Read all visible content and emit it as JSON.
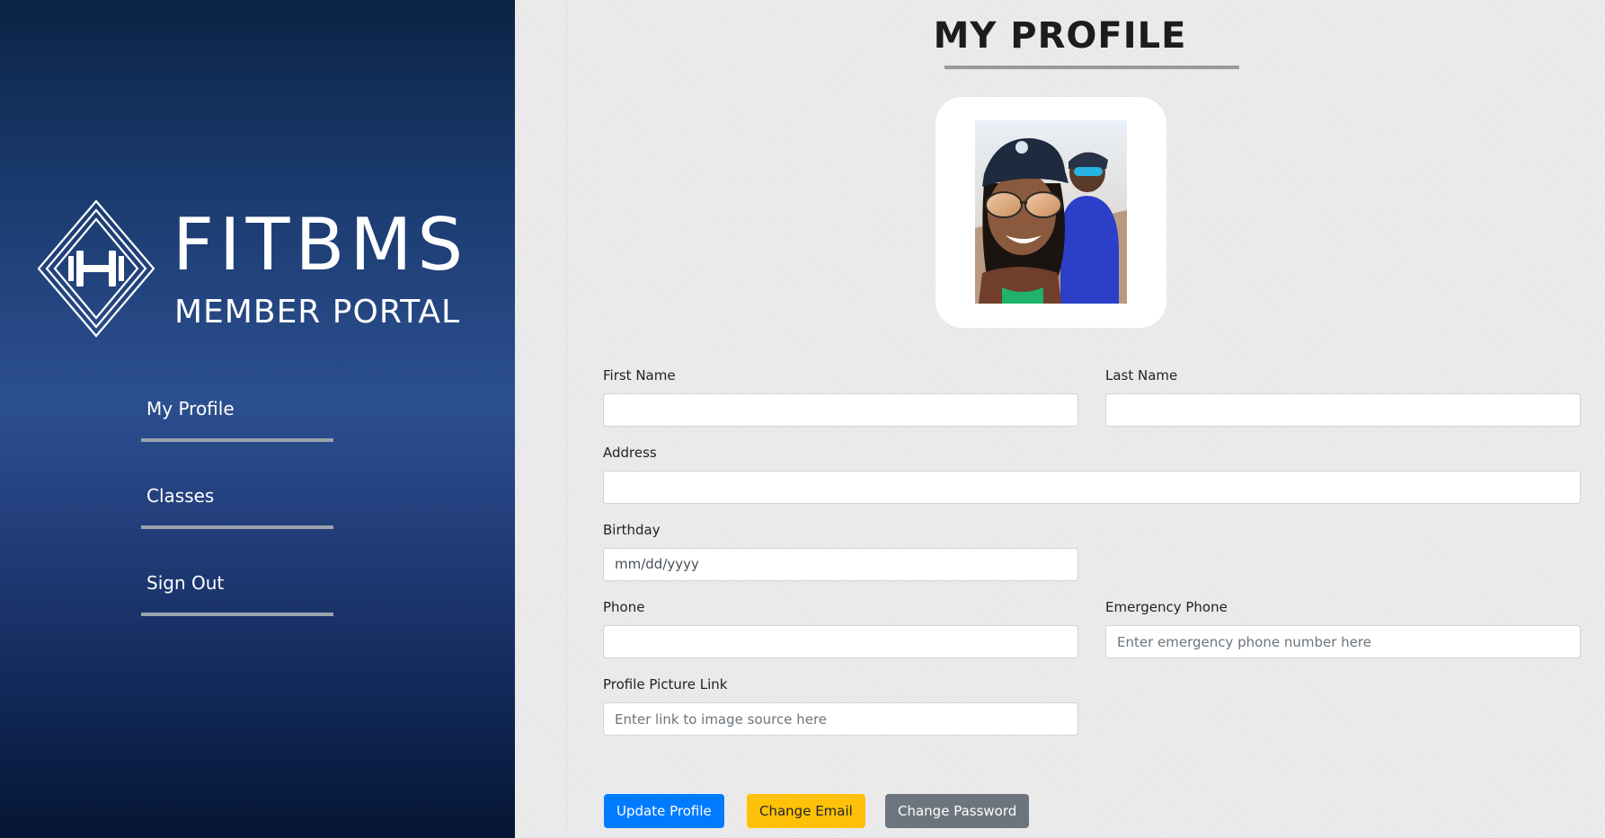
{
  "sidebar": {
    "logo": {
      "title": "FITBMS",
      "subtitle": "MEMBER PORTAL",
      "icon": "dumbbell-diamond-icon"
    },
    "nav_items": [
      {
        "label": "My Profile"
      },
      {
        "label": "Classes"
      },
      {
        "label": "Sign Out"
      }
    ]
  },
  "main": {
    "page_title": "MY PROFILE",
    "profile_picture": {
      "alt": "profile picture"
    },
    "form": {
      "first_name": {
        "label": "First Name",
        "value": "",
        "placeholder": ""
      },
      "last_name": {
        "label": "Last Name",
        "value": "",
        "placeholder": ""
      },
      "address": {
        "label": "Address",
        "value": "",
        "placeholder": ""
      },
      "birthday": {
        "label": "Birthday",
        "value": "mm/dd/yyyy"
      },
      "phone": {
        "label": "Phone",
        "value": "",
        "placeholder": ""
      },
      "emergency_phone": {
        "label": "Emergency Phone",
        "value": "",
        "placeholder": "Enter emergency phone number here"
      },
      "profile_picture_link": {
        "label": "Profile Picture Link",
        "value": "",
        "placeholder": "Enter link to image source here"
      }
    },
    "buttons": {
      "update_profile": "Update Profile",
      "change_email": "Change Email",
      "change_password": "Change Password"
    }
  },
  "colors": {
    "sidebar_top": "#0a2444",
    "sidebar_mid": "#2c4f8f",
    "sidebar_bottom": "#051533",
    "primary": "#007bff",
    "warning": "#ffc107",
    "secondary": "#6c757d",
    "nav_underline": "#9aa3ad"
  }
}
